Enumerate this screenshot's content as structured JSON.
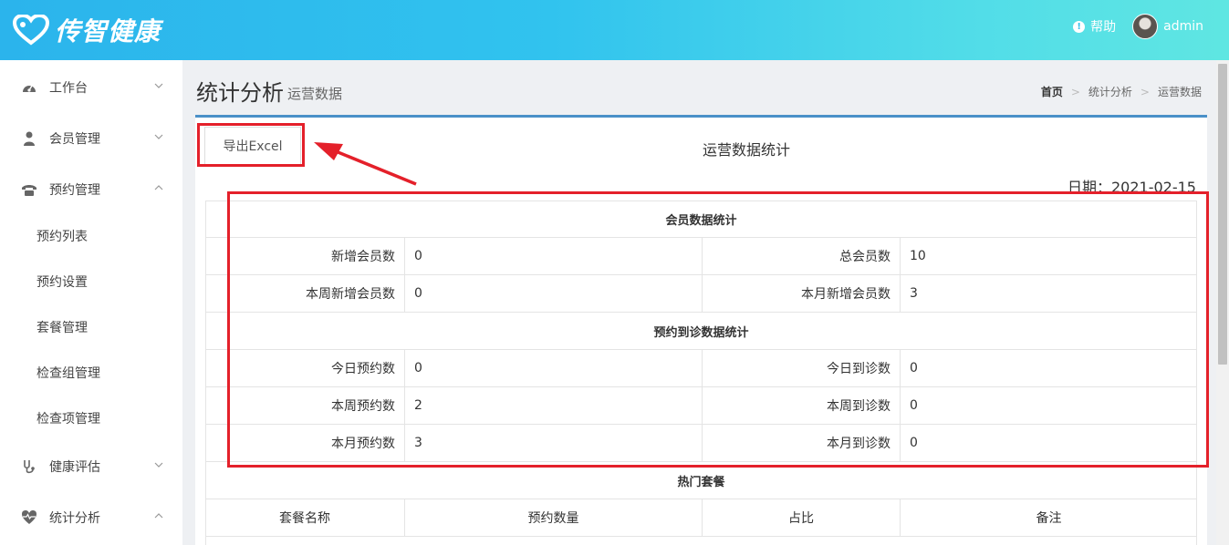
{
  "app": {
    "logo_text": "传智健康",
    "help_label": "帮助",
    "username": "admin"
  },
  "sidebar": {
    "items": [
      {
        "label": "工作台",
        "icon": "dashboard-icon",
        "expanded": false
      },
      {
        "label": "会员管理",
        "icon": "user-icon",
        "expanded": false
      },
      {
        "label": "预约管理",
        "icon": "phone-icon",
        "expanded": true
      },
      {
        "label": "健康评估",
        "icon": "stethoscope-icon",
        "expanded": false
      },
      {
        "label": "统计分析",
        "icon": "heartbeat-icon",
        "expanded": true
      }
    ],
    "sub_items": [
      "预约列表",
      "预约设置",
      "套餐管理",
      "检查组管理",
      "检查项管理"
    ]
  },
  "page": {
    "title": "统计分析",
    "subtitle": "运营数据",
    "breadcrumb": [
      "首页",
      "统计分析",
      "运营数据"
    ]
  },
  "report": {
    "export_label": "导出Excel",
    "title": "运营数据统计",
    "date_label": "日期：2021-02-15",
    "member_section": "会员数据统计",
    "member_rows": [
      {
        "l1": "新增会员数",
        "v1": "0",
        "l2": "总会员数",
        "v2": "10"
      },
      {
        "l1": "本周新增会员数",
        "v1": "0",
        "l2": "本月新增会员数",
        "v2": "3"
      }
    ],
    "order_section": "预约到诊数据统计",
    "order_rows": [
      {
        "l1": "今日预约数",
        "v1": "0",
        "l2": "今日到诊数",
        "v2": "0"
      },
      {
        "l1": "本周预约数",
        "v1": "2",
        "l2": "本周到诊数",
        "v2": "0"
      },
      {
        "l1": "本月预约数",
        "v1": "3",
        "l2": "本月到诊数",
        "v2": "0"
      }
    ],
    "hot_section": "热门套餐",
    "hot_headers": [
      "套餐名称",
      "预约数量",
      "占比",
      "备注"
    ]
  },
  "colors": {
    "header_gradient_start": "#2bb4ec",
    "header_gradient_end": "#5fe6e2",
    "annotation_red": "#e4202a",
    "panel_accent": "#4a90c8"
  }
}
